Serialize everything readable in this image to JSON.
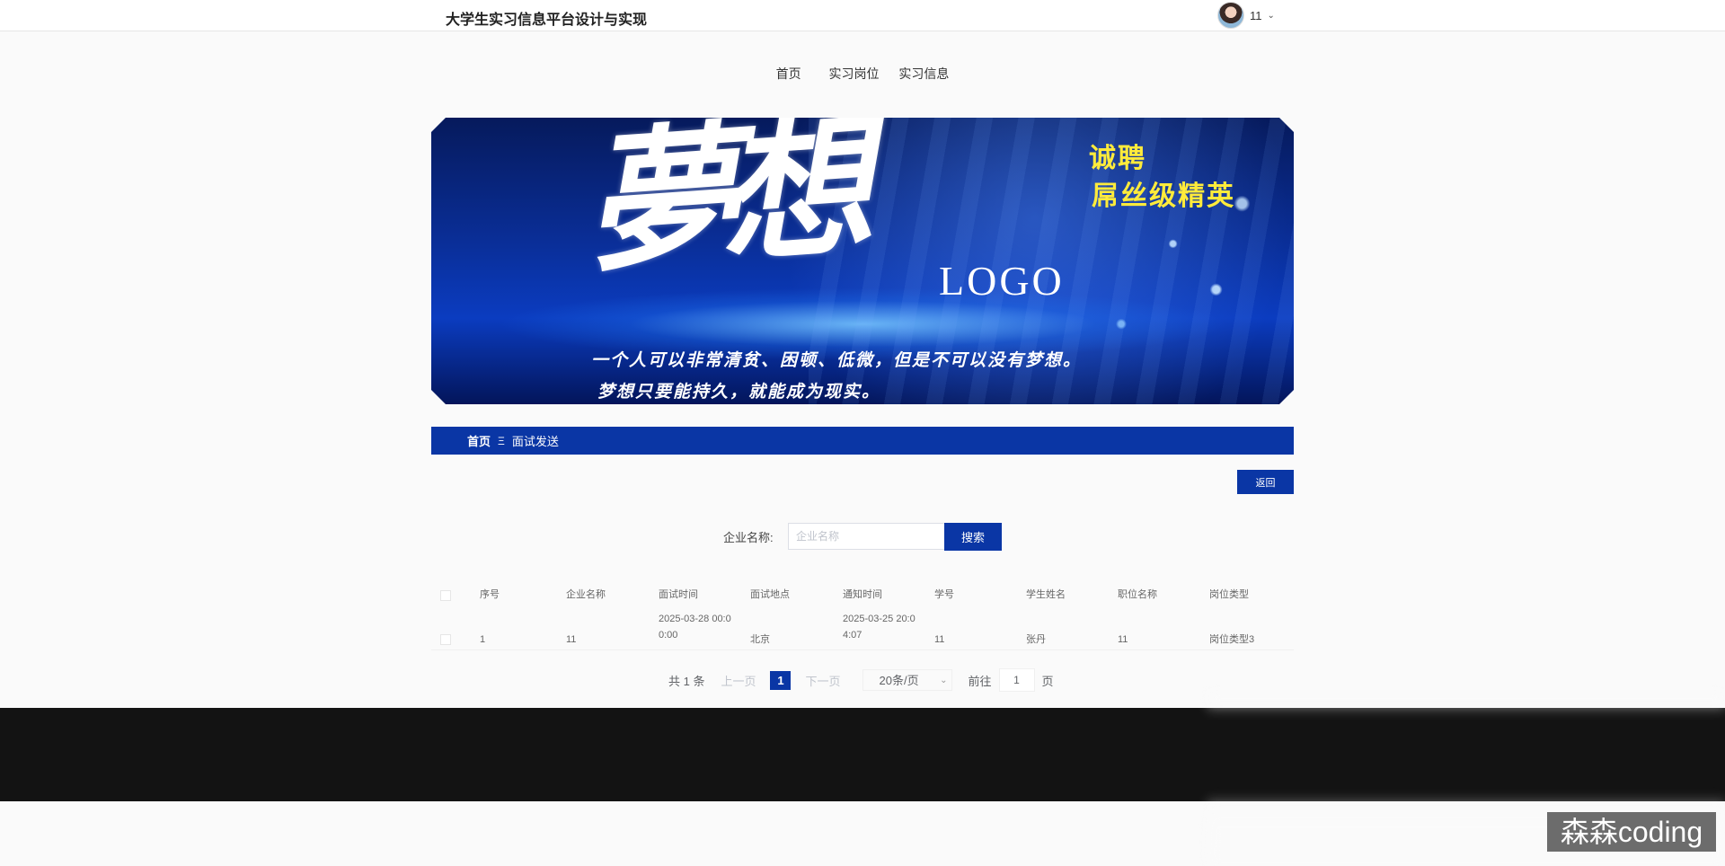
{
  "header": {
    "site_title": "大学生实习信息平台设计与实现",
    "user_name": "11",
    "user_icon": "chevron-down-icon"
  },
  "nav": {
    "items": [
      "首页",
      "实习岗位",
      "实习信息"
    ]
  },
  "banner": {
    "big_text": "夢想",
    "logo_text": "LOGO",
    "yellow_line1": "诚聘",
    "yellow_line2": "屌丝级精英",
    "line1": "一个人可以非常清贫、困顿、低微，但是不可以没有梦想。",
    "line2": "梦想只要能持久，就能成为现实。"
  },
  "breadcrumb": {
    "home": "首页",
    "separator": "Ξ",
    "current": "面试发送"
  },
  "actions": {
    "back_label": "返回"
  },
  "search": {
    "label": "企业名称:",
    "placeholder": "企业名称",
    "value": "",
    "button_label": "搜索"
  },
  "table": {
    "columns": [
      "序号",
      "企业名称",
      "面试时间",
      "面试地点",
      "通知时间",
      "学号",
      "学生姓名",
      "职位名称",
      "岗位类型"
    ],
    "rows": [
      [
        "1",
        "11",
        "2025-03-28 00:00:00",
        "北京",
        "2025-03-25 20:04:07",
        "11",
        "张丹",
        "11",
        "岗位类型3"
      ]
    ]
  },
  "pagination": {
    "total": "共 1 条",
    "prev": "上一页",
    "current_page": "1",
    "next": "下一页",
    "page_size": "20条/页",
    "goto_prefix": "前往",
    "goto_value": "1",
    "goto_suffix": "页"
  },
  "watermark": "森森coding",
  "colors": {
    "primary": "#0a36a5",
    "footer": "#131313",
    "background": "#fafafa"
  }
}
